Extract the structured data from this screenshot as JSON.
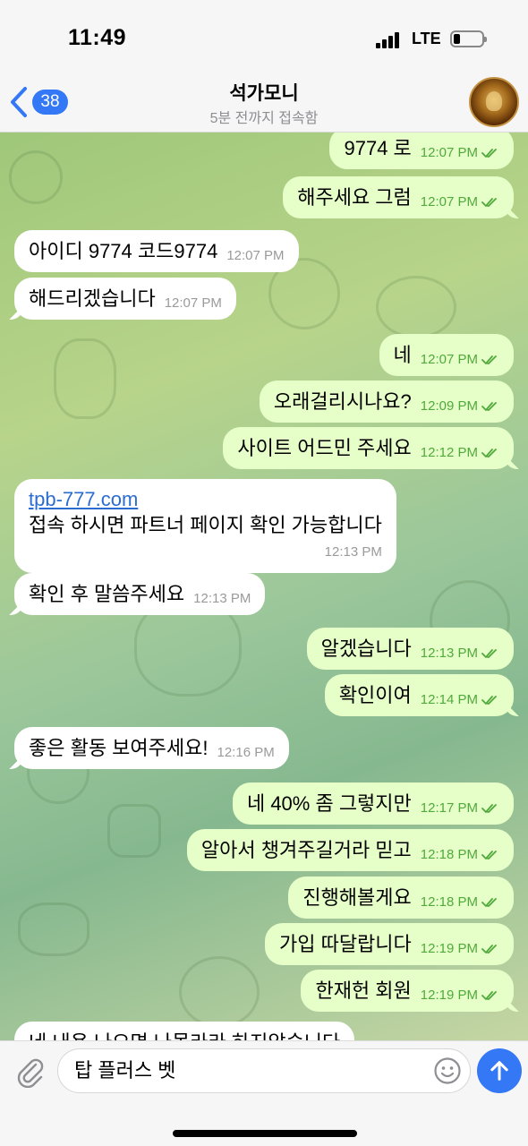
{
  "status_bar": {
    "time": "11:49",
    "network": "LTE"
  },
  "header": {
    "back_count": "38",
    "title": "석가모니",
    "subtitle": "5분 전까지 접속함"
  },
  "messages": [
    {
      "dir": "out",
      "text": "9774 로",
      "time": "12:07 PM"
    },
    {
      "dir": "out",
      "text": "해주세요 그럼",
      "time": "12:07 PM"
    },
    {
      "dir": "in",
      "text": "아이디 9774  코드9774",
      "time": "12:07 PM"
    },
    {
      "dir": "in",
      "text": "해드리겠습니다",
      "time": "12:07 PM"
    },
    {
      "dir": "out",
      "text": "네",
      "time": "12:07 PM"
    },
    {
      "dir": "out",
      "text": "오래걸리시나요?",
      "time": "12:09 PM"
    },
    {
      "dir": "out",
      "text": "사이트 어드민 주세요",
      "time": "12:12 PM"
    },
    {
      "dir": "in",
      "link": "tpb-777.com",
      "text": "접속 하시면 파트너 페이지 확인 가능합니다",
      "time": "12:13 PM"
    },
    {
      "dir": "in",
      "text": "확인 후 말씀주세요",
      "time": "12:13 PM"
    },
    {
      "dir": "out",
      "text": "알겠습니다",
      "time": "12:13 PM"
    },
    {
      "dir": "out",
      "text": "확인이여",
      "time": "12:14 PM"
    },
    {
      "dir": "in",
      "text": "좋은 활동 보여주세요!",
      "time": "12:16 PM"
    },
    {
      "dir": "out",
      "text": "네 40% 좀 그렇지만",
      "time": "12:17 PM"
    },
    {
      "dir": "out",
      "text": "알아서 챙겨주길거라 믿고",
      "time": "12:18 PM"
    },
    {
      "dir": "out",
      "text": "진행해볼게요",
      "time": "12:18 PM"
    },
    {
      "dir": "out",
      "text": "가입 따달랍니다",
      "time": "12:19 PM"
    },
    {
      "dir": "out",
      "text": "한재헌 회원",
      "time": "12:19 PM"
    },
    {
      "dir": "in",
      "text": "네 내용 나오면 나몰라라 하지않습니다",
      "time": ""
    }
  ],
  "composer": {
    "value": "탑 플러스 벳"
  },
  "colors": {
    "accent": "#3478f6",
    "outgoing_bubble": "#e6ffc8",
    "incoming_bubble": "#ffffff",
    "read_check": "#50a93b"
  },
  "icons": {
    "back": "chevron-left-icon",
    "attach": "paperclip-icon",
    "emoji": "smiley-icon",
    "send": "arrow-up-icon",
    "scroll": "chevron-down-icon"
  }
}
